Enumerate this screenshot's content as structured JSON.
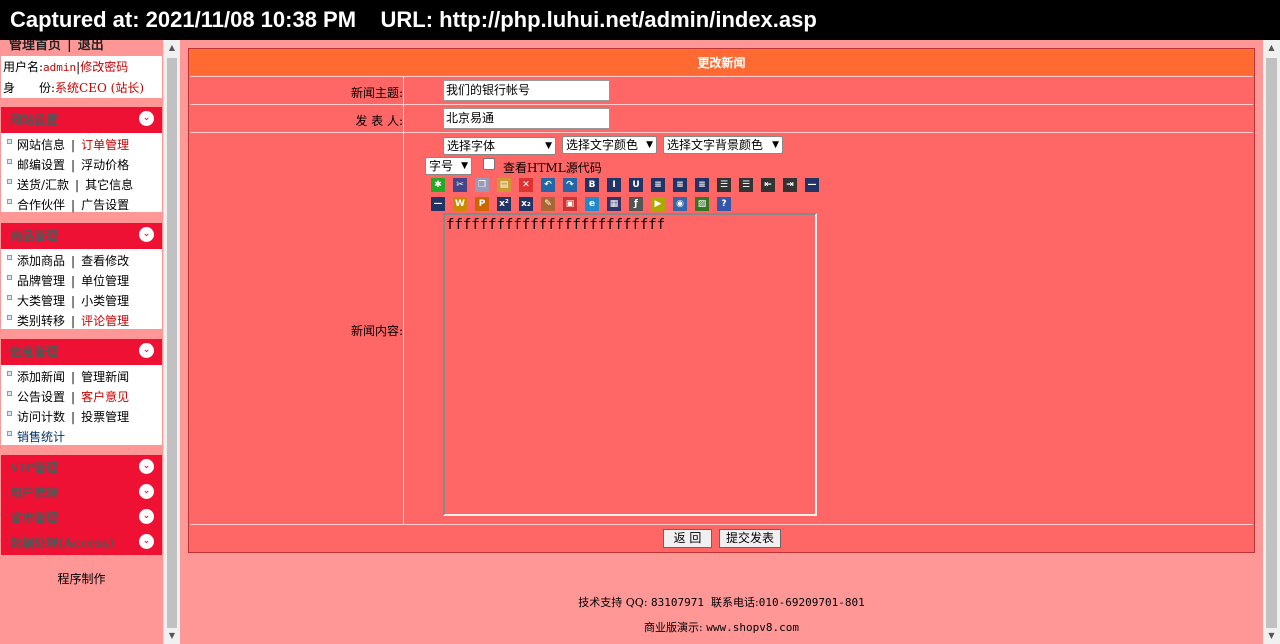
{
  "capture": {
    "caption": "Captured at: 2021/11/08 10:38 PM    URL: http://php.luhui.net/admin/index.asp"
  },
  "left": {
    "top_links": {
      "home": "管理首页",
      "sep": "|",
      "logout": "退出"
    },
    "user": {
      "username_label": "用户名:",
      "username": "admin",
      "sep": "|",
      "change_pwd": "修改密码",
      "role_label": "身　　份:",
      "role": "系统CEO (站长)"
    },
    "panels": [
      {
        "title": "网站设置",
        "rows": [
          [
            "网站信息",
            "订单管理"
          ],
          [
            "邮编设置",
            "浮动价格"
          ],
          [
            "送货/汇款",
            "其它信息"
          ],
          [
            "合作伙伴",
            "广告设置"
          ]
        ]
      },
      {
        "title": "商品管理",
        "rows": [
          [
            "添加商品",
            "查看修改"
          ],
          [
            "品牌管理",
            "单位管理"
          ],
          [
            "大类管理",
            "小类管理"
          ],
          [
            "类别转移",
            "评论管理"
          ]
        ]
      },
      {
        "title": "信息管理",
        "rows": [
          [
            "添加新闻",
            "管理新闻"
          ],
          [
            "公告设置",
            "客户意见"
          ],
          [
            "访问计数",
            "投票管理"
          ],
          [
            "销售统计",
            ""
          ]
        ]
      }
    ],
    "collapsed": [
      "VIP管理",
      "用户管理",
      "省市管理",
      "数据处理(Access)"
    ],
    "chevron": "⌄",
    "credit": "程序制作"
  },
  "form": {
    "header": "更改新闻",
    "subject_label": "新闻主题:",
    "subject_value": "我们的银行帐号",
    "author_label": "发 表 人:",
    "author_value": "北京易通",
    "content_label": "新闻内容:",
    "font_select": "选择字体",
    "color_select": "选择文字颜色",
    "bgcolor_select": "选择文字背景颜色",
    "size_select": "字号",
    "html_source_label": "查看HTML源代码",
    "editor_text": "ffffffffffffffffffffffffff",
    "back_button": "返 回",
    "submit_button": "提交发表"
  },
  "toolbar_row1": [
    "select-all-icon",
    "cut-icon",
    "copy-icon",
    "paste-icon",
    "delete-icon",
    "undo-icon",
    "redo-icon",
    "bold-icon",
    "italic-icon",
    "underline-icon",
    "align-left-icon",
    "align-center-icon",
    "align-right-icon",
    "numbered-list-icon",
    "bullet-list-icon",
    "outdent-icon",
    "indent-icon",
    "horizontal-rule-icon"
  ],
  "toolbar_row2": [
    "horizontal-line-icon",
    "web-link-icon",
    "page-link-icon",
    "superscript-icon",
    "subscript-icon",
    "marker-icon",
    "insert-page-icon",
    "insert-web-icon",
    "table-icon",
    "flash-icon",
    "media-icon",
    "movie-icon",
    "image-icon",
    "help-icon"
  ],
  "footer": {
    "support_label": "技术支持 QQ:",
    "support_qq": "83107971",
    "phone_label": "联系电话:",
    "phone": "010-69209701-801",
    "demo_label": "商业版演示:",
    "demo_url": "www.shopv8.com"
  }
}
